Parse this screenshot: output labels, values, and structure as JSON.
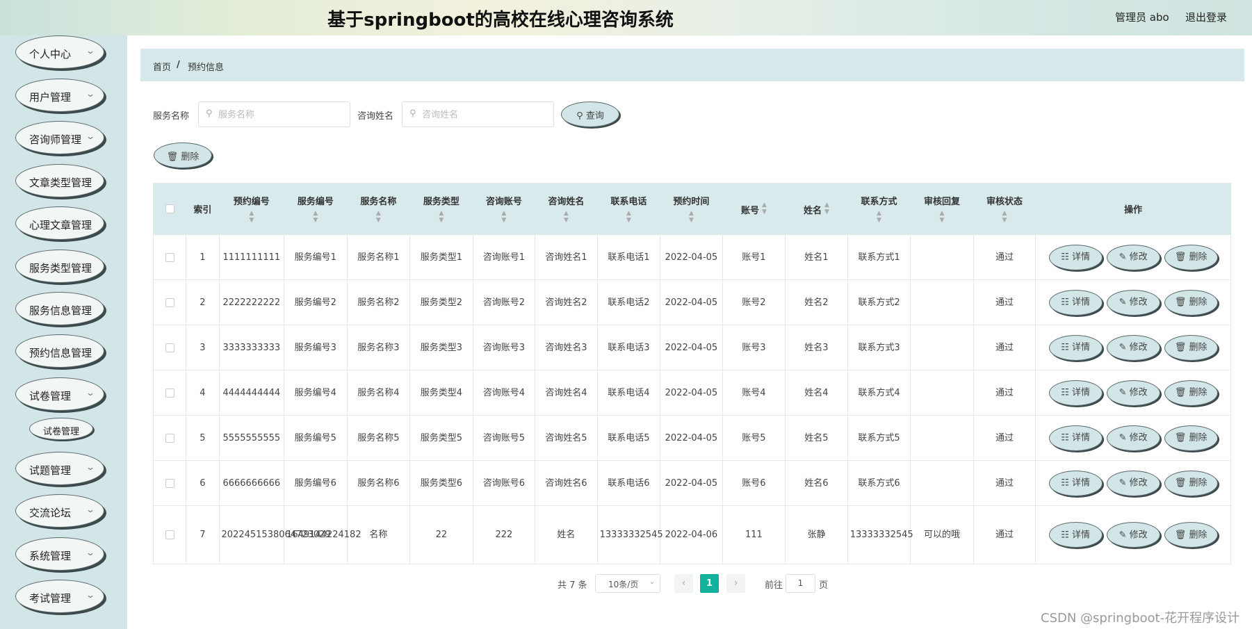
{
  "header": {
    "title": "基于springboot的高校在线心理咨询系统",
    "admin": "管理员 abo",
    "logout": "退出登录"
  },
  "sidebar": {
    "items": [
      {
        "label": "个人中心",
        "has_chevron": true
      },
      {
        "label": "用户管理",
        "has_chevron": true
      },
      {
        "label": "咨询师管理",
        "has_chevron": true
      },
      {
        "label": "文章类型管理",
        "has_chevron": false
      },
      {
        "label": "心理文章管理",
        "has_chevron": false
      },
      {
        "label": "服务类型管理",
        "has_chevron": false
      },
      {
        "label": "服务信息管理",
        "has_chevron": false
      },
      {
        "label": "预约信息管理",
        "has_chevron": false
      },
      {
        "label": "试卷管理",
        "has_chevron": true
      },
      {
        "label": "试题管理",
        "has_chevron": true
      },
      {
        "label": "交流论坛",
        "has_chevron": true
      },
      {
        "label": "系统管理",
        "has_chevron": true
      },
      {
        "label": "考试管理",
        "has_chevron": true
      }
    ],
    "sub_item": "试卷管理",
    "chevron_icon": "chevron-down-icon"
  },
  "breadcrumb": {
    "home": "首页",
    "separator": "/",
    "current": "预约信息"
  },
  "search": {
    "service_name_label": "服务名称",
    "service_name_placeholder": "服务名称",
    "consult_name_label": "咨询姓名",
    "consult_name_placeholder": "咨询姓名",
    "query_button": "查询",
    "delete_button": "删除"
  },
  "table": {
    "headers": [
      "索引",
      "预约编号",
      "服务编号",
      "服务名称",
      "服务类型",
      "咨询账号",
      "咨询姓名",
      "联系电话",
      "预约时间",
      "账号",
      "姓名",
      "联系方式",
      "审核回复",
      "审核状态",
      "操作"
    ],
    "rows": [
      [
        "1",
        "1111111111",
        "服务编号1",
        "服务名称1",
        "服务类型1",
        "咨询账号1",
        "咨询姓名1",
        "联系电话1",
        "2022-04-05",
        "账号1",
        "姓名1",
        "联系方式1",
        "",
        "通过"
      ],
      [
        "2",
        "2222222222",
        "服务编号2",
        "服务名称2",
        "服务类型2",
        "咨询账号2",
        "咨询姓名2",
        "联系电话2",
        "2022-04-05",
        "账号2",
        "姓名2",
        "联系方式2",
        "",
        "通过"
      ],
      [
        "3",
        "3333333333",
        "服务编号3",
        "服务名称3",
        "服务类型3",
        "咨询账号3",
        "咨询姓名3",
        "联系电话3",
        "2022-04-05",
        "账号3",
        "姓名3",
        "联系方式3",
        "",
        "通过"
      ],
      [
        "4",
        "4444444444",
        "服务编号4",
        "服务名称4",
        "服务类型4",
        "咨询账号4",
        "咨询姓名4",
        "联系电话4",
        "2022-04-05",
        "账号4",
        "姓名4",
        "联系方式4",
        "",
        "通过"
      ],
      [
        "5",
        "5555555555",
        "服务编号5",
        "服务名称5",
        "服务类型5",
        "咨询账号5",
        "咨询姓名5",
        "联系电话5",
        "2022-04-05",
        "账号5",
        "姓名5",
        "联系方式5",
        "",
        "通过"
      ],
      [
        "6",
        "6666666666",
        "服务编号6",
        "服务名称6",
        "服务类型6",
        "咨询账号6",
        "咨询姓名6",
        "联系电话6",
        "2022-04-05",
        "账号6",
        "姓名6",
        "联系方式6",
        "",
        "通过"
      ],
      [
        "7",
        "2022451538064723029",
        "1649144224182",
        "名称",
        "22",
        "222",
        "姓名",
        "13333332545",
        "2022-04-06",
        "111",
        "张静",
        "13333332545",
        "可以的哦",
        "通过"
      ]
    ],
    "actions": [
      "详情",
      "修改",
      "删除"
    ]
  },
  "pagination": {
    "total": "共 7 条",
    "page_size": "10条/页",
    "current_page": "1",
    "goto_label": "前往",
    "goto_value": "1",
    "page_label": "页"
  },
  "watermark": "CSDN @springboot-花开程序设计",
  "colors": {
    "accent": "#11b19b",
    "sidebar_bg": "#d3e6e7",
    "button_bg": "#d3e6e7",
    "header_bg": "#d9eaec"
  }
}
